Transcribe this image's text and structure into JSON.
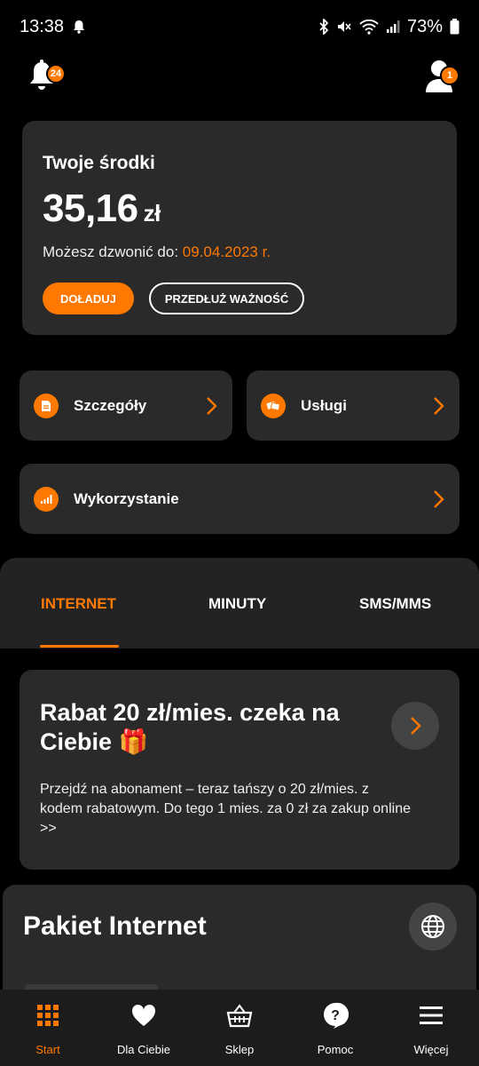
{
  "status_bar": {
    "time": "13:38",
    "battery": "73%"
  },
  "notifications": {
    "badge_count": "24"
  },
  "profile": {
    "badge_count": "1"
  },
  "balance": {
    "title": "Twoje środki",
    "amount": "35,16",
    "currency": "zł",
    "valid_label": "Możesz dzwonić do: ",
    "valid_date": "09.04.2023 r.",
    "topup_label": "DOŁADUJ",
    "extend_label": "PRZEDŁUŻ WAŻNOŚĆ"
  },
  "tiles": {
    "details": "Szczegóły",
    "services": "Usługi",
    "usage": "Wykorzystanie"
  },
  "tabs": [
    "INTERNET",
    "MINUTY",
    "SMS/MMS"
  ],
  "promo": {
    "title": "Rabat 20 zł/mies. czeka na Ciebie 🎁",
    "text": "Przejdź na abonament – teraz tańszy o 20 zł/mies. z kodem rabatowym. Do tego 1 mies. za 0 zł za zakup online >>"
  },
  "package": {
    "title": "Pakiet Internet"
  },
  "nav": [
    "Start",
    "Dla Ciebie",
    "Sklep",
    "Pomoc",
    "Więcej"
  ],
  "colors": {
    "accent": "#ff7900",
    "card": "#2a2a2a",
    "background": "#000000"
  },
  "icons": {
    "status": [
      "bell-icon",
      "bluetooth-icon",
      "mute-icon",
      "wifi-icon",
      "signal-icon",
      "battery-icon"
    ],
    "nav": [
      "grid-icon",
      "heart-icon",
      "basket-icon",
      "help-icon",
      "menu-icon"
    ]
  }
}
